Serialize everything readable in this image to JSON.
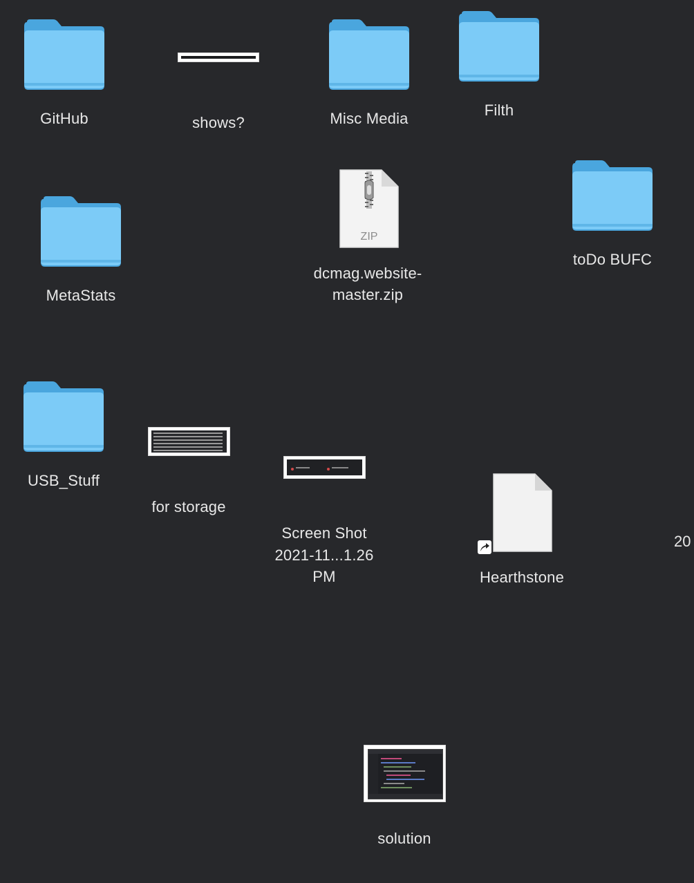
{
  "desktop": {
    "items": [
      {
        "id": "github",
        "kind": "folder",
        "label": "GitHub"
      },
      {
        "id": "shows",
        "kind": "screenshot",
        "label": "shows?"
      },
      {
        "id": "misc-media",
        "kind": "folder",
        "label": "Misc Media"
      },
      {
        "id": "filth",
        "kind": "folder",
        "label": "Filth"
      },
      {
        "id": "metastats",
        "kind": "folder",
        "label": "MetaStats"
      },
      {
        "id": "dcmag",
        "kind": "zip",
        "label_line1": "dcmag.website-",
        "label_line2": "master.zip",
        "badge": "ZIP"
      },
      {
        "id": "todo-bufc",
        "kind": "folder",
        "label": "toDo BUFC"
      },
      {
        "id": "usb-stuff",
        "kind": "folder",
        "label": "USB_Stuff"
      },
      {
        "id": "for-storage",
        "kind": "screenshot",
        "label": "for storage"
      },
      {
        "id": "screenshot",
        "kind": "screenshot",
        "label_line1": "Screen Shot",
        "label_line2": "2021-11...1.26 PM"
      },
      {
        "id": "hearthstone",
        "kind": "alias-document",
        "label": "Hearthstone"
      },
      {
        "id": "solution",
        "kind": "screenshot",
        "label": "solution"
      }
    ],
    "edge_label": "20"
  },
  "colors": {
    "background": "#27282b",
    "folder_back": "#5cb5ea",
    "folder_front": "#7ccbf7",
    "label_text": "#e8e8e8"
  },
  "icons": {
    "folder": "folder-icon",
    "zip": "zip-archive-icon",
    "document": "document-icon",
    "alias": "alias-arrow-icon",
    "screenshot": "screenshot-thumbnail-icon"
  }
}
